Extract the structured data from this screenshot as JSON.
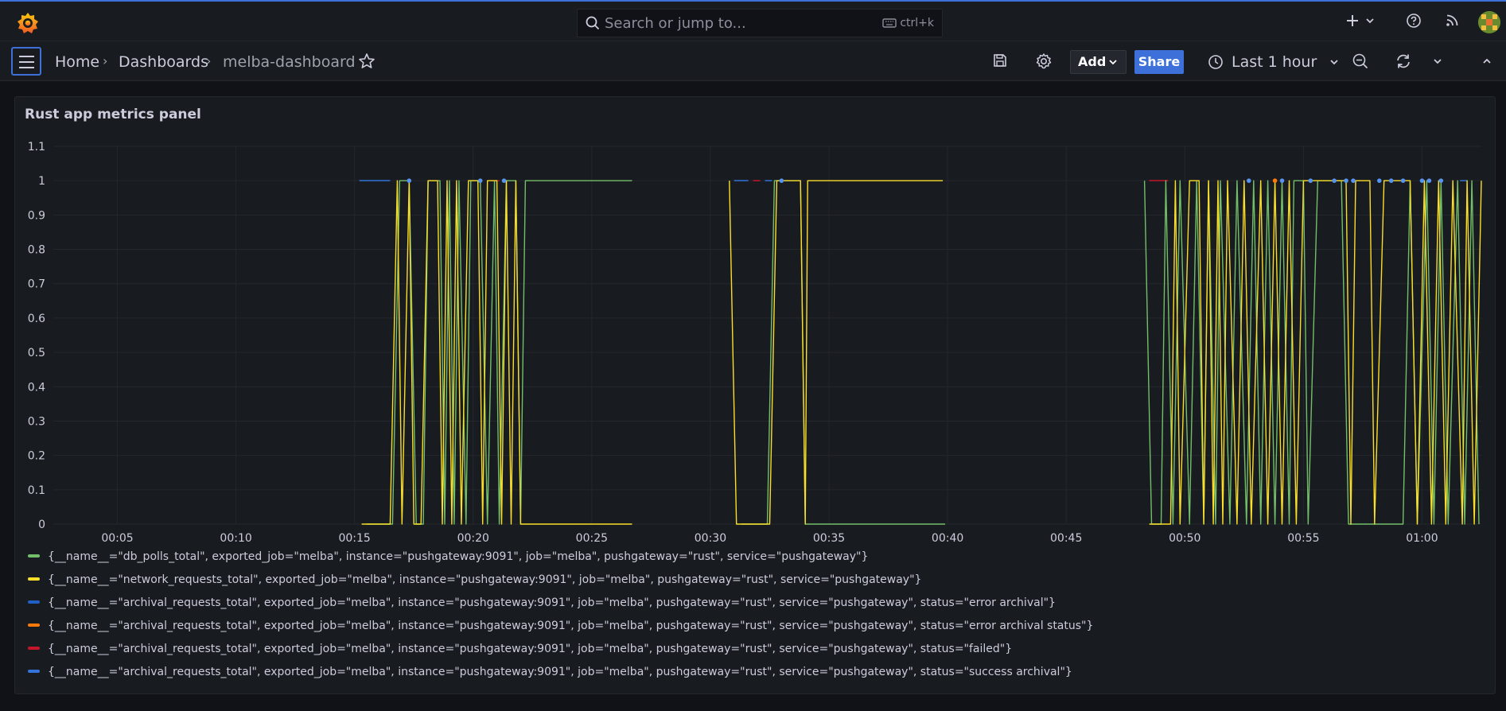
{
  "topbar": {
    "search_placeholder": "Search or jump to...",
    "search_shortcut": "ctrl+k",
    "icons": [
      "grafana-logo-icon",
      "search-icon",
      "keyboard-icon",
      "plus-icon",
      "chevron-down-icon",
      "help-icon",
      "rss-icon",
      "avatar"
    ]
  },
  "subbar": {
    "breadcrumbs": [
      "Home",
      "Dashboards",
      "melba-dashboard"
    ],
    "add_label": "Add",
    "share_label": "Share",
    "time_range": "Last 1 hour"
  },
  "panel": {
    "title": "Rust app metrics panel"
  },
  "colors": {
    "db_polls": "#73bf69",
    "network": "#fade2a",
    "error_archival": "#1f60c4",
    "error_archival_status": "#ff780a",
    "failed": "#c4162a",
    "success": "#3274d9",
    "dots": "#5794f2"
  },
  "chart_data": {
    "type": "line",
    "title": "Rust app metrics panel",
    "x_ticks": [
      "00:05",
      "00:10",
      "00:15",
      "00:20",
      "00:25",
      "00:30",
      "00:35",
      "00:40",
      "00:45",
      "00:50",
      "00:55",
      "01:00"
    ],
    "y_ticks": [
      "0",
      "0.1",
      "0.2",
      "0.3",
      "0.4",
      "0.5",
      "0.6",
      "0.7",
      "0.8",
      "0.9",
      "1",
      "1.1"
    ],
    "ylim": [
      0,
      1.1
    ],
    "grid": true,
    "legend_placement": "bottom",
    "series": [
      {
        "name": "{__name__=\"db_polls_total\", exported_job=\"melba\", instance=\"pushgateway:9091\", job=\"melba\", pushgateway=\"rust\", service=\"pushgateway\"}",
        "color": "#73bf69",
        "segments": [
          [
            [
              15.5,
              0
            ],
            [
              16.6,
              0
            ],
            [
              16.9,
              1
            ],
            [
              17.3,
              1
            ],
            [
              17.6,
              0
            ],
            [
              17.9,
              0
            ],
            [
              18.1,
              1
            ],
            [
              18.6,
              1
            ],
            [
              18.8,
              0
            ],
            [
              19.0,
              1
            ],
            [
              19.2,
              0
            ],
            [
              19.4,
              1
            ],
            [
              19.7,
              0
            ],
            [
              19.9,
              1
            ],
            [
              20.3,
              1
            ],
            [
              20.6,
              0
            ],
            [
              20.9,
              1
            ],
            [
              21.1,
              0
            ],
            [
              21.4,
              1
            ],
            [
              21.8,
              1
            ],
            [
              22.0,
              0
            ],
            [
              22.2,
              1
            ],
            [
              26.7,
              1
            ]
          ],
          [
            [
              31.3,
              0
            ],
            [
              32.4,
              0
            ],
            [
              32.7,
              1
            ],
            [
              33.8,
              1
            ],
            [
              34.0,
              0
            ],
            [
              34.4,
              0
            ],
            [
              39.9,
              0
            ]
          ],
          [
            [
              48.3,
              1
            ],
            [
              48.6,
              0
            ],
            [
              49.0,
              0
            ],
            [
              49.2,
              1
            ],
            [
              49.5,
              0
            ],
            [
              49.8,
              1
            ],
            [
              50.2,
              0
            ],
            [
              50.5,
              1
            ],
            [
              50.8,
              0
            ],
            [
              51.0,
              1
            ],
            [
              51.3,
              0
            ],
            [
              51.5,
              1
            ],
            [
              51.9,
              0
            ],
            [
              52.2,
              1
            ],
            [
              52.6,
              0
            ],
            [
              52.9,
              1
            ],
            [
              53.2,
              0
            ],
            [
              53.5,
              1
            ],
            [
              53.8,
              0
            ],
            [
              54.1,
              1
            ],
            [
              54.4,
              0
            ],
            [
              54.6,
              1
            ],
            [
              55.0,
              1
            ],
            [
              55.2,
              0
            ],
            [
              55.6,
              1
            ],
            [
              56.6,
              1
            ],
            [
              56.9,
              0
            ],
            [
              59.2,
              0
            ],
            [
              59.5,
              1
            ],
            [
              59.8,
              0
            ],
            [
              60.2,
              1
            ],
            [
              60.5,
              0
            ],
            [
              60.8,
              1
            ],
            [
              61.1,
              0
            ],
            [
              61.5,
              1
            ],
            [
              61.8,
              0
            ],
            [
              62.1,
              1
            ],
            [
              62.4,
              0
            ]
          ]
        ]
      },
      {
        "name": "{__name__=\"network_requests_total\", exported_job=\"melba\", instance=\"pushgateway:9091\", job=\"melba\", pushgateway=\"rust\", service=\"pushgateway\"}",
        "color": "#fade2a",
        "segments": [
          [
            [
              15.3,
              0
            ],
            [
              16.5,
              0
            ],
            [
              16.8,
              1
            ],
            [
              17.0,
              0
            ],
            [
              17.3,
              1
            ],
            [
              17.5,
              0
            ],
            [
              17.8,
              0
            ],
            [
              18.1,
              1
            ],
            [
              18.5,
              1
            ],
            [
              18.7,
              0
            ],
            [
              18.9,
              1
            ],
            [
              19.1,
              0
            ],
            [
              19.3,
              1
            ],
            [
              19.5,
              0
            ],
            [
              19.8,
              1
            ],
            [
              20.2,
              1
            ],
            [
              20.4,
              0
            ],
            [
              20.6,
              1
            ],
            [
              21.0,
              1
            ],
            [
              21.2,
              0
            ],
            [
              21.4,
              1
            ],
            [
              21.6,
              0
            ],
            [
              21.8,
              1
            ],
            [
              22.0,
              0
            ],
            [
              26.7,
              0
            ]
          ],
          [
            [
              30.8,
              1
            ],
            [
              31.1,
              0
            ],
            [
              32.5,
              0
            ],
            [
              32.8,
              1
            ],
            [
              33.8,
              1
            ],
            [
              34.0,
              0
            ],
            [
              34.1,
              1
            ],
            [
              39.8,
              1
            ]
          ],
          [
            [
              48.5,
              0
            ],
            [
              49.4,
              0
            ],
            [
              49.6,
              1
            ],
            [
              49.8,
              0
            ],
            [
              50.2,
              1
            ],
            [
              50.6,
              1
            ],
            [
              50.8,
              0
            ],
            [
              51.0,
              1
            ],
            [
              51.2,
              0
            ],
            [
              51.4,
              1
            ],
            [
              51.6,
              0
            ],
            [
              51.8,
              1
            ],
            [
              52.2,
              0
            ],
            [
              52.5,
              1
            ],
            [
              52.8,
              0
            ],
            [
              53.2,
              1
            ],
            [
              53.5,
              0
            ],
            [
              53.8,
              1
            ],
            [
              54.1,
              0
            ],
            [
              54.4,
              1
            ],
            [
              54.7,
              0
            ],
            [
              55.0,
              1
            ],
            [
              56.8,
              1
            ],
            [
              57.0,
              0
            ],
            [
              57.2,
              1
            ],
            [
              57.8,
              1
            ],
            [
              58.0,
              0
            ],
            [
              58.4,
              1
            ],
            [
              59.5,
              1
            ],
            [
              59.8,
              0
            ],
            [
              60.1,
              1
            ],
            [
              60.4,
              0
            ],
            [
              60.7,
              1
            ],
            [
              61.0,
              0
            ],
            [
              61.3,
              1
            ],
            [
              61.7,
              0
            ],
            [
              61.9,
              1
            ],
            [
              62.2,
              0
            ],
            [
              62.5,
              1
            ]
          ]
        ]
      }
    ],
    "flat_one_segments": [
      {
        "color": "#3274d9",
        "x": [
          15.2,
          16.5
        ]
      },
      {
        "color": "#3274d9",
        "x": [
          31.0,
          31.6
        ]
      },
      {
        "color": "#c4162a",
        "x": [
          31.8,
          32.1
        ]
      },
      {
        "color": "#3274d9",
        "x": [
          32.3,
          32.6
        ]
      },
      {
        "color": "#c4162a",
        "x": [
          20.8,
          21.1
        ]
      },
      {
        "color": "#c4162a",
        "x": [
          48.5,
          49.3
        ]
      },
      {
        "color": "#3274d9",
        "x": [
          61.6,
          61.9
        ]
      }
    ],
    "dots": [
      {
        "x": 17.3,
        "color": "#5794f2"
      },
      {
        "x": 20.3,
        "color": "#5794f2"
      },
      {
        "x": 21.3,
        "color": "#5794f2"
      },
      {
        "x": 33.0,
        "color": "#5794f2"
      },
      {
        "x": 52.7,
        "color": "#5794f2"
      },
      {
        "x": 53.8,
        "color": "#ff780a"
      },
      {
        "x": 54.1,
        "color": "#5794f2"
      },
      {
        "x": 55.3,
        "color": "#5794f2"
      },
      {
        "x": 56.3,
        "color": "#5794f2"
      },
      {
        "x": 56.8,
        "color": "#5794f2"
      },
      {
        "x": 57.1,
        "color": "#5794f2"
      },
      {
        "x": 58.2,
        "color": "#5794f2"
      },
      {
        "x": 58.7,
        "color": "#5794f2"
      },
      {
        "x": 59.2,
        "color": "#5794f2"
      },
      {
        "x": 60.0,
        "color": "#5794f2"
      },
      {
        "x": 60.3,
        "color": "#5794f2"
      },
      {
        "x": 60.8,
        "color": "#5794f2"
      }
    ],
    "x_range_minutes": [
      2.3,
      62.5
    ]
  },
  "legend": [
    {
      "label": "{__name__=\"db_polls_total\", exported_job=\"melba\", instance=\"pushgateway:9091\", job=\"melba\", pushgateway=\"rust\", service=\"pushgateway\"}",
      "color": "#73bf69"
    },
    {
      "label": "{__name__=\"network_requests_total\", exported_job=\"melba\", instance=\"pushgateway:9091\", job=\"melba\", pushgateway=\"rust\", service=\"pushgateway\"}",
      "color": "#fade2a"
    },
    {
      "label": "{__name__=\"archival_requests_total\", exported_job=\"melba\", instance=\"pushgateway:9091\", job=\"melba\", pushgateway=\"rust\", service=\"pushgateway\", status=\"error archival\"}",
      "color": "#1f60c4"
    },
    {
      "label": "{__name__=\"archival_requests_total\", exported_job=\"melba\", instance=\"pushgateway:9091\", job=\"melba\", pushgateway=\"rust\", service=\"pushgateway\", status=\"error archival status\"}",
      "color": "#ff780a"
    },
    {
      "label": "{__name__=\"archival_requests_total\", exported_job=\"melba\", instance=\"pushgateway:9091\", job=\"melba\", pushgateway=\"rust\", service=\"pushgateway\", status=\"failed\"}",
      "color": "#c4162a"
    },
    {
      "label": "{__name__=\"archival_requests_total\", exported_job=\"melba\", instance=\"pushgateway:9091\", job=\"melba\", pushgateway=\"rust\", service=\"pushgateway\", status=\"success archival\"}",
      "color": "#3274d9"
    }
  ]
}
